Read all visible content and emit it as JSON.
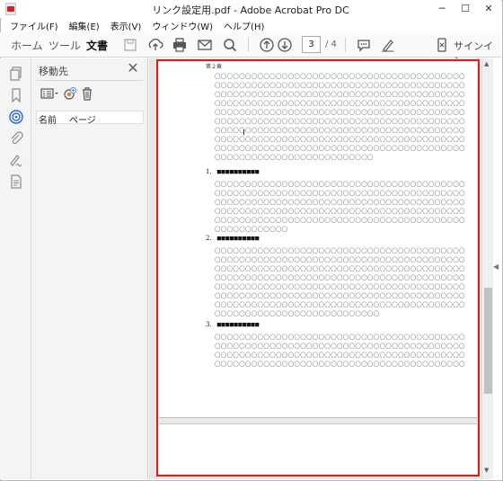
{
  "window": {
    "title": "リンク設定用.pdf - Adobe Acrobat Pro DC",
    "min_glyph": "─",
    "max_glyph": "☐",
    "close_glyph": "✕"
  },
  "menubar": [
    "ファイル(F)",
    "編集(E)",
    "表示(V)",
    "ウィンドウ(W)",
    "ヘルプ(H)"
  ],
  "toolbar": {
    "tabs": [
      "ホーム",
      "ツール",
      "文書"
    ],
    "active_tab": "文書",
    "current_page": "3",
    "total_pages": "/ 4",
    "signin_label": "サインイン",
    "icons": [
      "save-icon",
      "upload-icon",
      "print-icon",
      "mail-icon",
      "search-icon",
      "page-up-icon",
      "page-down-icon",
      "comment-icon",
      "pen-icon",
      "mobile-icon"
    ]
  },
  "left_rail": {
    "icons": [
      "pages-icon",
      "bookmark-icon",
      "destinations-icon",
      "attachment-icon",
      "signature-icon",
      "document-icon"
    ],
    "active": "destinations-icon"
  },
  "dest_panel": {
    "title": "移動先",
    "close_glyph": "✕",
    "columns": [
      "名前",
      "ページ"
    ]
  },
  "document": {
    "chapter_label": "第２章",
    "circle_line": "〇〇〇〇〇〇〇〇〇〇〇〇〇〇〇〇〇〇〇〇〇〇〇〇〇〇〇〇〇〇〇〇〇〇〇〇〇〇〇〇〇",
    "intro_last": "〇〇〇〇〇〇〇〇〇〇〇〇〇〇〇〇〇〇〇〇〇〇〇〇〇〇",
    "sections": [
      {
        "number": "1.",
        "title": "■■■■■■■■■■",
        "last_line": "〇〇〇〇〇〇〇〇〇〇〇〇"
      },
      {
        "number": "2.",
        "title": "■■■■■■■■■■",
        "last_line": "〇〇〇〇〇〇〇〇〇〇〇〇〇〇〇〇〇〇〇〇〇〇〇〇〇〇〇"
      },
      {
        "number": "3.",
        "title": "■■■■■■■■■■",
        "last_line": "〇〇〇〇〇〇〇〇〇〇〇〇〇〇〇〇〇〇〇〇〇〇〇〇〇〇〇〇〇〇〇〇〇〇〇〇〇〇〇〇〇"
      }
    ]
  },
  "colors": {
    "highlight": "#d3201f",
    "active_rail_icon": "#2b6fd6"
  }
}
